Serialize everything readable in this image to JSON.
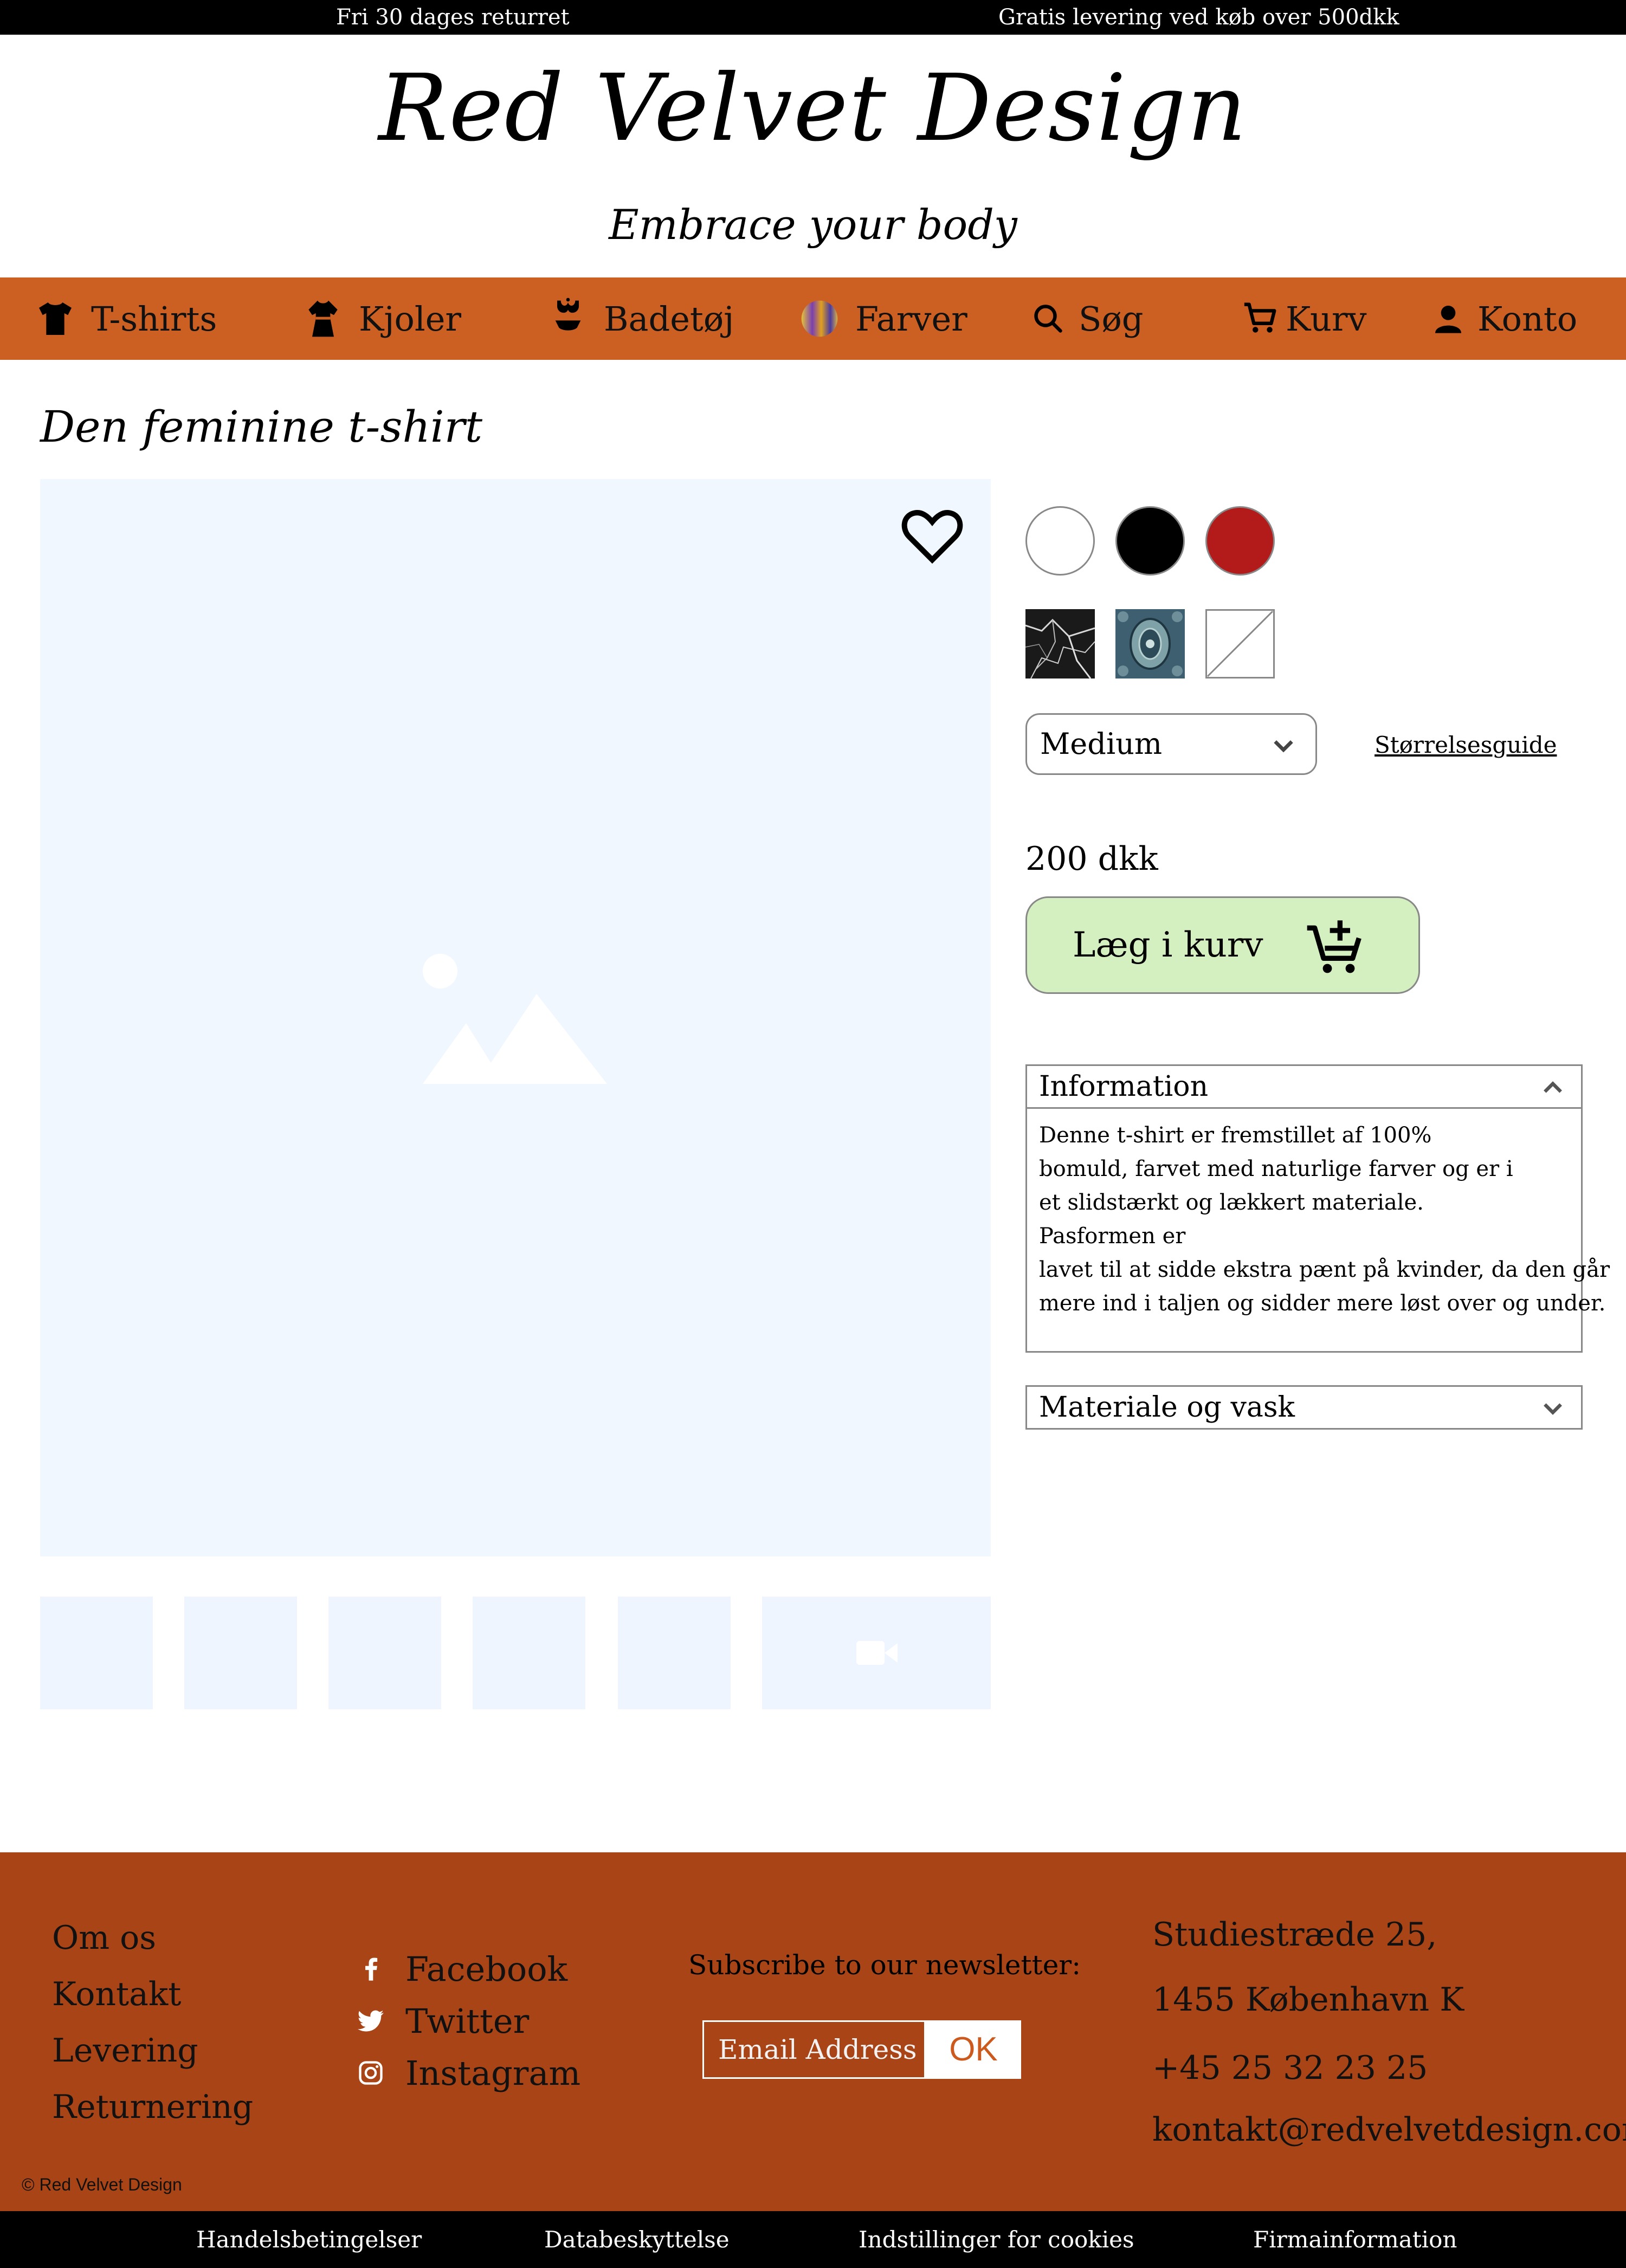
{
  "topbar": {
    "left": "Fri 30 dages returret",
    "right": "Gratis levering ved køb over 500dkk"
  },
  "header": {
    "logo": "Red Velvet Design",
    "tagline": "Embrace your body"
  },
  "nav": {
    "items": [
      {
        "label": "T-shirts",
        "icon": "tshirt-icon"
      },
      {
        "label": "Kjoler",
        "icon": "dress-icon"
      },
      {
        "label": "Badetøj",
        "icon": "swimwear-icon"
      },
      {
        "label": "Farver",
        "icon": "colors-icon"
      },
      {
        "label": "Søg",
        "icon": "search-icon"
      },
      {
        "label": "Kurv",
        "icon": "cart-icon"
      },
      {
        "label": "Konto",
        "icon": "account-icon"
      }
    ]
  },
  "product": {
    "title": "Den feminine t-shirt",
    "colors": [
      "#ffffff",
      "#000000",
      "#b31b1b"
    ],
    "patterns": [
      "marble-black",
      "paisley-blue",
      "none"
    ],
    "size": "Medium",
    "size_guide": "Størrelsesguide",
    "price": "200 dkk",
    "add_to_cart": "Læg i kurv",
    "info_title": "Information",
    "info_lines": [
      "Denne t-shirt er fremstillet af 100%",
      "bomuld, farvet med naturlige farver og er i",
      "et slidstærkt og lækkert materiale.",
      "Pasformen er",
      "lavet til at sidde ekstra pænt på kvinder, da den går",
      "mere ind i taljen og sidder mere løst over og under."
    ],
    "material_title": "Materiale og vask"
  },
  "footer": {
    "links": [
      "Om os",
      "Kontakt",
      "Levering",
      "Returnering"
    ],
    "social": [
      {
        "label": "Facebook",
        "icon": "facebook-icon"
      },
      {
        "label": "Twitter",
        "icon": "twitter-icon"
      },
      {
        "label": "Instagram",
        "icon": "instagram-icon"
      }
    ],
    "newsletter_label": "Subscribe to our newsletter:",
    "email_placeholder": "Email Address",
    "ok_label": "OK",
    "contact": [
      "Studiestræde 25,",
      "1455 København K",
      "+45 25 32 23 25",
      "kontakt@redvelvetdesign.com"
    ],
    "copyright": "© Red Velvet Design"
  },
  "bottombar": {
    "links": [
      "Handelsbetingelser",
      "Databeskyttelse",
      "Indstillinger for cookies",
      "Firmainformation"
    ]
  },
  "colors": {
    "nav_bg": "#cc6022",
    "footer_bg": "#a84416",
    "image_placeholder": "#f0f7ff",
    "cart_button": "#d4f0c0"
  }
}
